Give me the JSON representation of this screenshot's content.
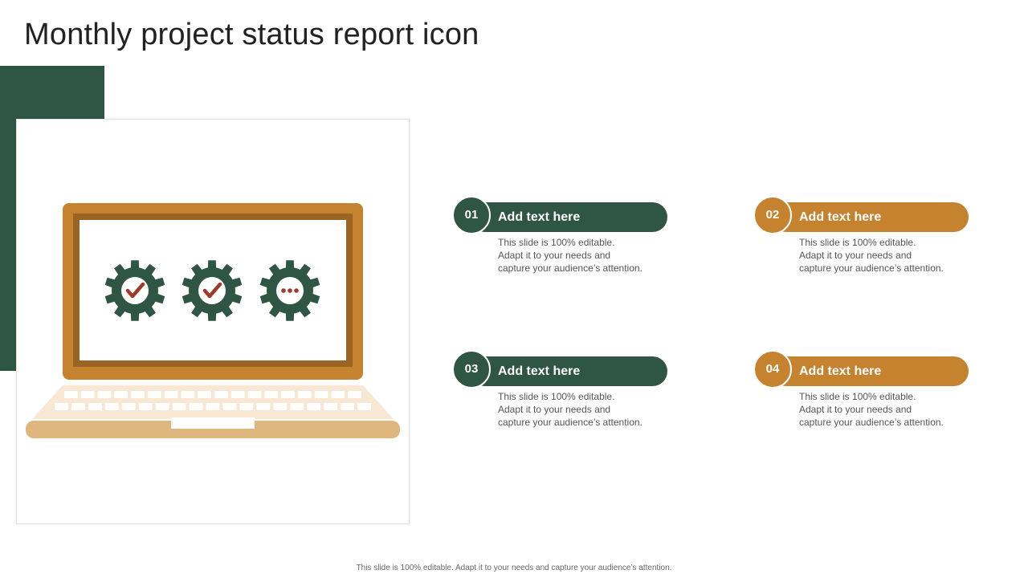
{
  "title": "Monthly project status report icon",
  "colors": {
    "green": "#2f5545",
    "orange": "#c5832f",
    "light_orange": "#dfb67e",
    "brown": "#9a6424",
    "cream": "#f7e7d3",
    "mark_red": "#a03a26"
  },
  "illustration": {
    "icon": "laptop-icon",
    "gears": [
      "check-mark-icon",
      "check-mark-icon",
      "ellipsis-icon"
    ]
  },
  "items": [
    {
      "number": "01",
      "heading": "Add text here",
      "lines": [
        "This slide is 100% editable.",
        "Adapt it to your needs and",
        "capture your audience’s attention."
      ]
    },
    {
      "number": "02",
      "heading": "Add text here",
      "lines": [
        "This slide is 100% editable.",
        "Adapt it to your needs and",
        "capture your audience’s attention."
      ]
    },
    {
      "number": "03",
      "heading": "Add text here",
      "lines": [
        "This slide is 100% editable.",
        "Adapt it to your needs and",
        "capture your audience’s attention."
      ]
    },
    {
      "number": "04",
      "heading": "Add text here",
      "lines": [
        "This slide is 100% editable.",
        "Adapt it to your needs and",
        "capture your audience’s attention."
      ]
    }
  ],
  "footer": "This slide is 100% editable. Adapt it to your needs and capture your audience’s attention."
}
